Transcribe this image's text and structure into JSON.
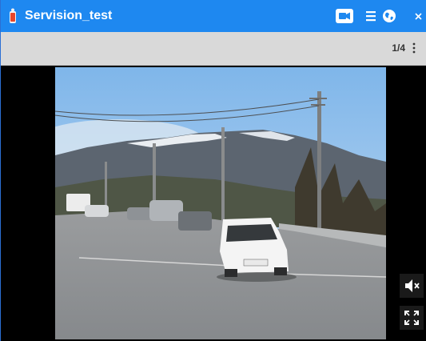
{
  "window": {
    "title": "Servision_test"
  },
  "titlebar": {
    "buttons": [
      {
        "name": "camera-button",
        "icon": "camera-icon"
      },
      {
        "name": "menu-button",
        "icon": "hamburger-menu-icon"
      },
      {
        "name": "globe-button",
        "icon": "globe-icon"
      },
      {
        "name": "close-button",
        "icon": "close-icon"
      }
    ]
  },
  "toolbar": {
    "page_indicator": "1/4",
    "more_icon": "vertical-dots-icon"
  },
  "video": {
    "description_icon": "video-feed",
    "controls": [
      {
        "name": "mute-button",
        "icon": "speaker-muted-icon"
      },
      {
        "name": "fullscreen-button",
        "icon": "fullscreen-icon"
      }
    ]
  },
  "colors": {
    "titlebar": "#1e88f0",
    "toolbar": "#d9d9d9",
    "background": "#000000",
    "app_icon": "#e8462a"
  }
}
